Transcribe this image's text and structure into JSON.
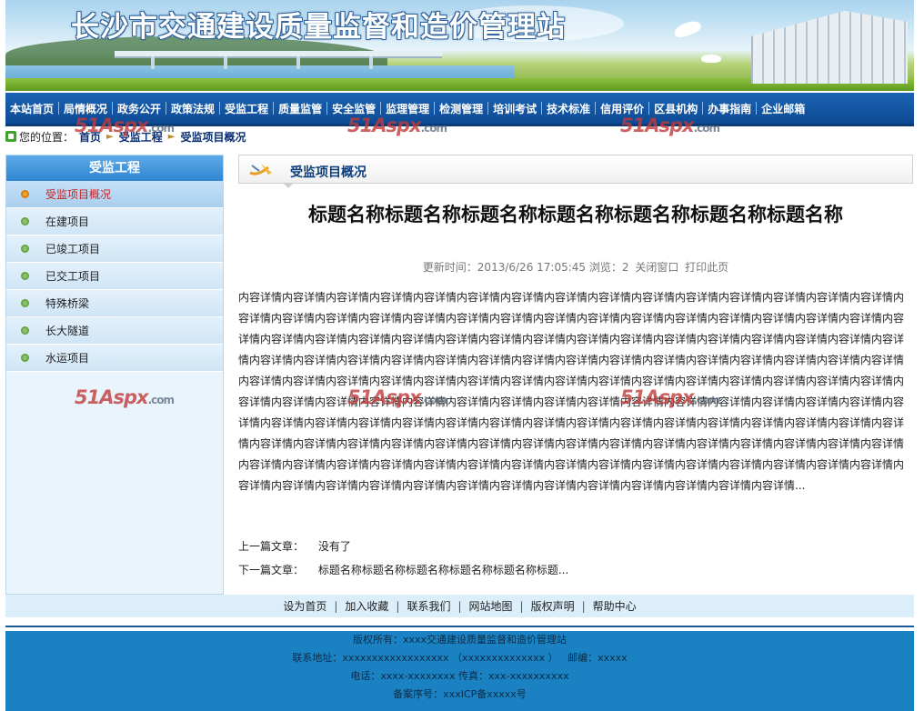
{
  "site": {
    "title": "长沙市交通建设质量监督和造价管理站"
  },
  "nav": {
    "items": [
      "本站首页",
      "局情概况",
      "政务公开",
      "政策法规",
      "受监工程",
      "质量监管",
      "安全监管",
      "监理管理",
      "检测管理",
      "培训考试",
      "技术标准",
      "信用评价",
      "区县机构",
      "办事指南",
      "企业邮箱"
    ]
  },
  "breadcrumb": {
    "prefix": "您的位置：",
    "items": [
      "首页",
      "受监工程",
      "受监项目概况"
    ]
  },
  "watermark": {
    "text": "51Aspx",
    "suffix": ".com"
  },
  "sidebar": {
    "title": "受监工程",
    "items": [
      "受监项目概况",
      "在建项目",
      "已竣工项目",
      "已交工项目",
      "特殊桥梁",
      "长大隧道",
      "水运项目"
    ]
  },
  "article": {
    "section_title": "受监项目概况",
    "title": "标题名称标题名称标题名称标题名称标题名称标题名称标题名称",
    "meta_prefix": "更新时间：2013/6/26 17:05:45 浏览：2",
    "close_label": "关闭窗口",
    "print_label": "打印此页",
    "body": "内容详情内容详情内容详情内容详情内容详情内容详情内容详情内容详情内容详情内容详情内容详情内容详情内容详情内容详情内容详情内容详情内容详情内容详情内容详情内容详情内容详情内容详情内容详情内容详情内容详情内容详情内容详情内容详情内容详情内容详情内容详情内容详情内容详情内容详情内容详情内容详情内容详情内容详情内容详情内容详情内容详情内容详情内容详情内容详情内容详情内容详情内容详情内容详情内容详情内容详情内容详情内容详情内容详情内容详情内容详情内容详情内容详情内容详情内容详情内容详情内容详情内容详情内容详情内容详情内容详情内容详情内容详情内容详情内容详情内容详情内容详情内容详情内容详情内容详情内容详情内容详情内容详情内容详情内容详情内容详情内容详情内容详情内容详情内容详情内容详情内容详情内容详情内容详情内容详情内容详情内容详情内容详情内容详情内容详情内容详情内容详情内容详情内容详情内容详情内容详情内容详情内容详情内容详情内容详情内容详情内容详情内容详情内容详情内容详情内容详情内容详情内容详情内容详情内容详情内容详情内容详情内容详情内容详情内容详情内容详情内容详情内容详情内容详情内容详情内容详情内容详情内容详情内容详情内容详情内容详情内容详情内容详情内容详情内容详情内容详情内容详情内容详情内容详情内容详情内容详情内容详情内容详情内容详情内容详情内容详情内容详情内容详情内容详情内容详情内容详情...",
    "prev_label": "上一篇文章：",
    "prev_value": "没有了",
    "next_label": "下一篇文章：",
    "next_value": "标题名称标题名称标题名称标题名称标题名称标题..."
  },
  "footer": {
    "links": [
      "设为首页",
      "加入收藏",
      "联系我们",
      "网站地图",
      "版权声明",
      "帮助中心"
    ],
    "copyright": "版权所有：xxxx交通建设质量监督和造价管理站",
    "address": "联系地址：xxxxxxxxxxxxxxxxxx （xxxxxxxxxxxxxx ）   邮编：xxxxx",
    "phone": "电话：xxxx-xxxxxxxx 传真：xxx-xxxxxxxxxx",
    "icp": "备案序号：xxxICP备xxxxx号"
  }
}
